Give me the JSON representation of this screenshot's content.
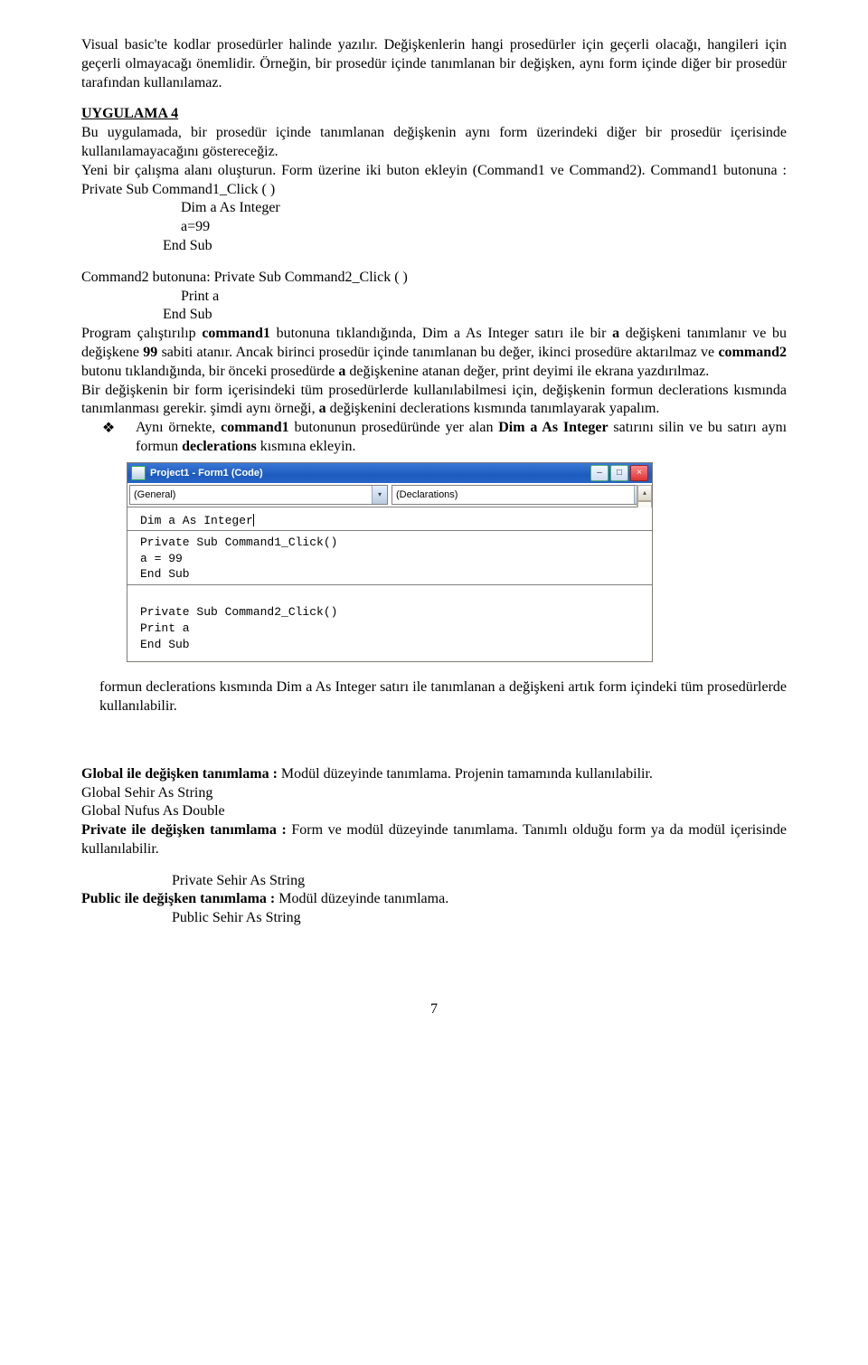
{
  "intro": {
    "p1": "Visual basic'te kodlar prosedürler halinde yazılır. Değişkenlerin hangi prosedürler için geçerli olacağı, hangileri için geçerli olmayacağı önemlidir. Örneğin, bir prosedür içinde tanımlanan bir değişken, aynı form içinde diğer bir prosedür tarafından kullanılamaz."
  },
  "uygulama": {
    "heading": "UYGULAMA 4",
    "p1": "Bu uygulamada, bir prosedür içinde tanımlanan değişkenin aynı form üzerindeki diğer bir prosedür içerisinde kullanılamayacağını göstereceğiz.",
    "p2": "Yeni bir çalışma alanı oluşturun. Form üzerine iki buton ekleyin (Command1 ve Command2). Command1 butonuna : Private Sub Command1_Click ( )",
    "code1_l1": "Dim a As Integer",
    "code1_l2": "a=99",
    "code1_l3": "End Sub",
    "cmd2_head": "Command2 butonuna: Private Sub Command2_Click ( )",
    "code2_l1": "Print a",
    "code2_l2": "End Sub",
    "p3": "Program çalıştırılıp command1 butonuna tıklandığında, Dim a As Integer satırı ile bir a değişkeni tanımlanır ve bu değişkene 99 sabiti atanır. Ancak birinci prosedür içinde tanımlanan bu değer, ikinci prosedüre aktarılmaz ve command2 butonu tıklandığında, bir önceki prosedürde a değişkenine atanan değer, print deyimi ile ekrana yazdırılmaz.",
    "p4": "Bir değişkenin bir form içerisindeki tüm prosedürlerde kullanılabilmesi için, değişkenin formun declerations kısmında tanımlanması gerekir. şimdi aynı örneği, a değişkenini declerations kısmında tanımlayarak yapalım.",
    "diamond_text": "Aynı örnekte, command1 butonunun prosedüründe yer alan Dim a As Integer satırını silin ve bu satırı aynı formun declerations kısmına ekleyin.",
    "p5": "formun declerations kısmında Dim a As Integer satırı ile tanımlanan a değişkeni artık form içindeki tüm prosedürlerde kullanılabilir."
  },
  "vbwin": {
    "title": "Project1 - Form1 (Code)",
    "dd_left": "(General)",
    "dd_right": "(Declarations)",
    "lines": {
      "l1": "Dim a As Integer",
      "l2": "Private Sub Command1_Click()",
      "l3": "a = 99",
      "l4": "End Sub",
      "l5": "Private Sub Command2_Click()",
      "l6": "Print a",
      "l7": "End Sub"
    }
  },
  "global_sec": {
    "p1a": "Global ile değişken tanımlama :",
    "p1b": " Modül düzeyinde tanımlama. Projenin tamamında kullanılabilir.",
    "g1": "Global Sehir As String",
    "g2": "Global Nufus As Double",
    "p2a": "Private ile değişken tanımlama :",
    "p2b": " Form ve modül düzeyinde tanımlama. Tanımlı olduğu form ya da modül içerisinde kullanılabilir.",
    "priv": "Private  Sehir As String",
    "p3a": "Public ile değişken tanımlama :",
    "p3b": " Modül düzeyinde tanımlama.",
    "pub": "Public  Sehir As String"
  },
  "pagenum": "7"
}
